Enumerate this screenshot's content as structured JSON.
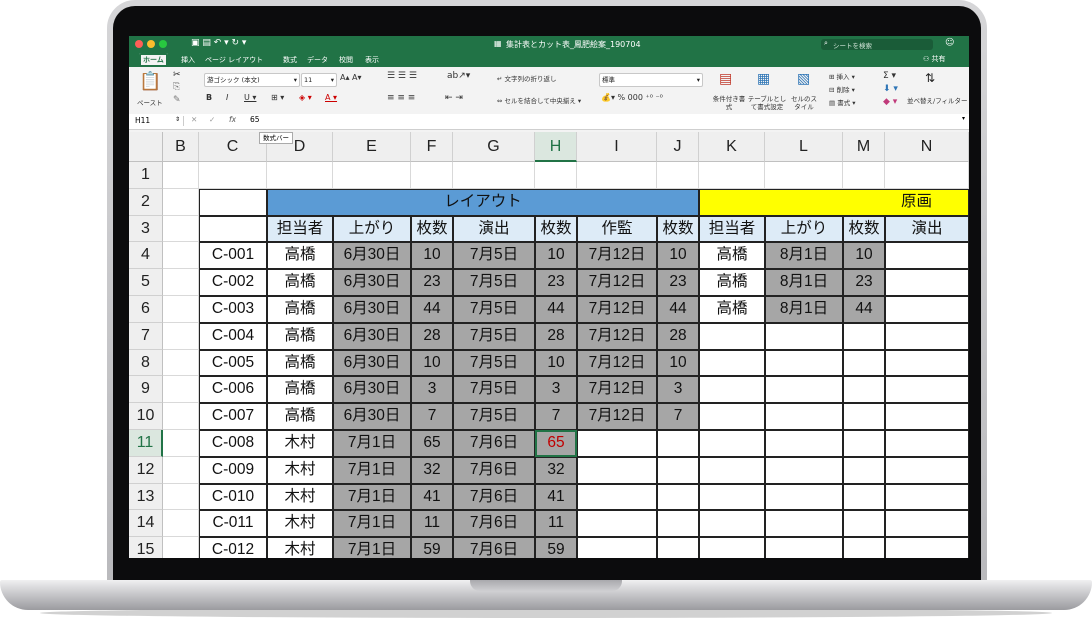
{
  "window": {
    "title": "集計表とカット表_鳳肥絵案_190704",
    "search_placeholder": "シートを検索",
    "share_label": "共有"
  },
  "ribbon_tabs": [
    "ホーム",
    "挿入",
    "ページ レイアウト",
    "数式",
    "データ",
    "校閲",
    "表示"
  ],
  "ribbon": {
    "paste_label": "ペースト",
    "font_name": "游ゴシック (本文)",
    "font_size": "11",
    "wrap_text_label": "文字列の折り返し",
    "merge_center_label": "セルを結合して中央揃え",
    "number_format": "標準",
    "conditional_format_label": "条件付き書式",
    "table_format_label": "テーブルとして書式設定",
    "cell_style_label": "セルのスタイル",
    "insert_label": "挿入",
    "delete_label": "削除",
    "format_label": "書式",
    "sort_filter_label": "並べ替え/フィルター"
  },
  "formula_bar": {
    "name_box": "H11",
    "fx": "fx",
    "value": "65",
    "tooltip": "数式バー"
  },
  "columns": [
    "B",
    "C",
    "D",
    "E",
    "F",
    "G",
    "H",
    "I",
    "J",
    "K",
    "L",
    "M",
    "N"
  ],
  "selected_column": "H",
  "selected_row": "11",
  "rows": [
    "1",
    "2",
    "3",
    "4",
    "5",
    "6",
    "7",
    "8",
    "9",
    "10",
    "11",
    "12",
    "13",
    "14",
    "15"
  ],
  "table": {
    "layout_header": "レイアウト",
    "genga_header": "原画",
    "subheaders": [
      "担当者",
      "上がり",
      "枚数",
      "演出",
      "枚数",
      "作監",
      "枚数",
      "担当者",
      "上がり",
      "枚数",
      "演出"
    ],
    "data_rows": [
      [
        "C-001",
        "高橋",
        "6月30日",
        "10",
        "7月5日",
        "10",
        "7月12日",
        "10",
        "高橋",
        "8月1日",
        "10"
      ],
      [
        "C-002",
        "高橋",
        "6月30日",
        "23",
        "7月5日",
        "23",
        "7月12日",
        "23",
        "高橋",
        "8月1日",
        "23"
      ],
      [
        "C-003",
        "高橋",
        "6月30日",
        "44",
        "7月5日",
        "44",
        "7月12日",
        "44",
        "高橋",
        "8月1日",
        "44"
      ],
      [
        "C-004",
        "高橋",
        "6月30日",
        "28",
        "7月5日",
        "28",
        "7月12日",
        "28",
        "",
        "",
        ""
      ],
      [
        "C-005",
        "高橋",
        "6月30日",
        "10",
        "7月5日",
        "10",
        "7月12日",
        "10",
        "",
        "",
        ""
      ],
      [
        "C-006",
        "高橋",
        "6月30日",
        "3",
        "7月5日",
        "3",
        "7月12日",
        "3",
        "",
        "",
        ""
      ],
      [
        "C-007",
        "高橋",
        "6月30日",
        "7",
        "7月5日",
        "7",
        "7月12日",
        "7",
        "",
        "",
        ""
      ],
      [
        "C-008",
        "木村",
        "7月1日",
        "65",
        "7月6日",
        "65",
        "",
        "",
        "",
        "",
        ""
      ],
      [
        "C-009",
        "木村",
        "7月1日",
        "32",
        "7月6日",
        "32",
        "",
        "",
        "",
        "",
        ""
      ],
      [
        "C-010",
        "木村",
        "7月1日",
        "41",
        "7月6日",
        "41",
        "",
        "",
        "",
        "",
        ""
      ],
      [
        "C-011",
        "木村",
        "7月1日",
        "11",
        "7月6日",
        "11",
        "",
        "",
        "",
        "",
        ""
      ],
      [
        "C-012",
        "木村",
        "7月1日",
        "59",
        "7月6日",
        "59",
        "",
        "",
        "",
        "",
        ""
      ]
    ]
  },
  "colors": {
    "excel_green": "#217346",
    "header_blue": "#5b9bd5",
    "header_yellow": "#ffff00",
    "cell_gray": "#a6a6a6",
    "active_text": "#c00000"
  }
}
